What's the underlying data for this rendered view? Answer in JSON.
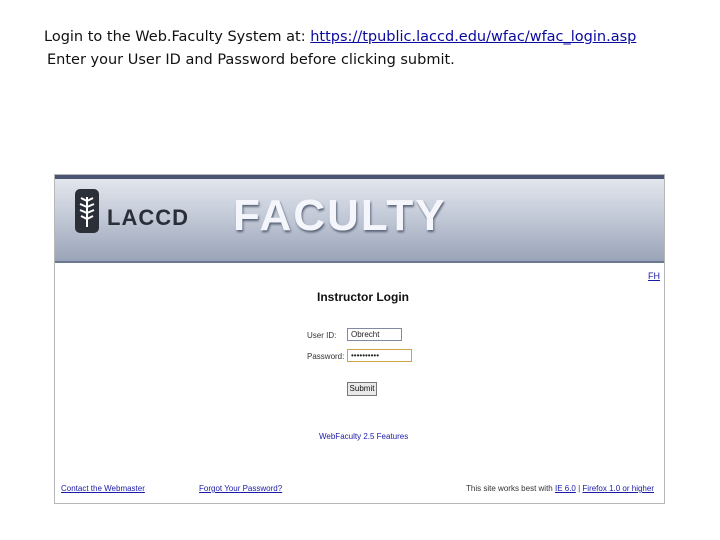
{
  "caption": {
    "line1_prefix": "Login to the Web.Faculty System at: ",
    "line1_url": "https://tpublic.laccd.edu/wfac/wfac_login.asp",
    "line2": "Enter your User ID and Password before clicking submit."
  },
  "banner": {
    "logo_text": "LACCD",
    "title": "FACULTY"
  },
  "top_link": "FH",
  "login": {
    "title": "Instructor Login",
    "user_label": "User ID:",
    "user_value": "Obrecht",
    "pass_label": "Password:",
    "pass_value": "••••••••••",
    "submit_label": "Submit"
  },
  "features_link": "WebFaculty 2.5 Features",
  "footer": {
    "contact": "Contact the Webmaster",
    "forgot": "Forgot Your Password?",
    "browser_prefix": "This site works best with ",
    "browser_link1": "IE 6.0",
    "browser_sep": " | ",
    "browser_link2": "Firefox 1.0 or higher"
  }
}
